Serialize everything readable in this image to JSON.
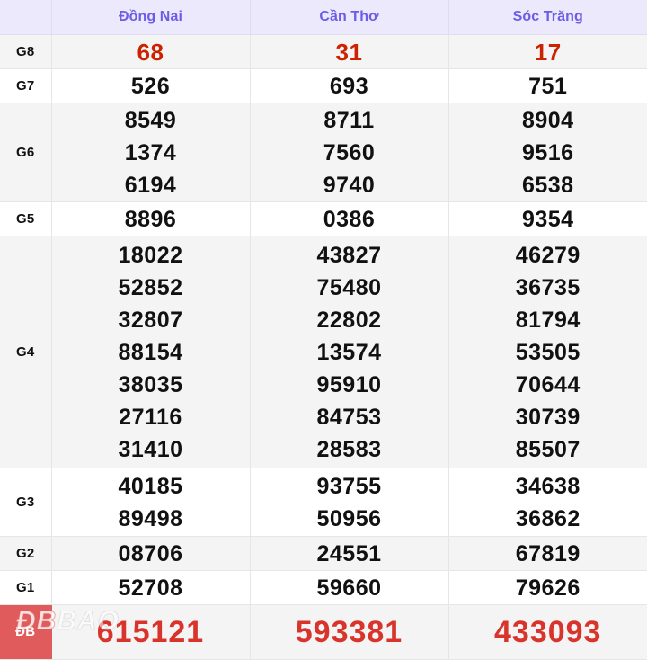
{
  "table": {
    "corner_label": "",
    "provinces": [
      "Đồng Nai",
      "Cần Thơ",
      "Sóc Trăng"
    ],
    "header_text_color": "#6c5ce7",
    "header_bg_color": "#ebe9fb",
    "accent_red": "#cc2200",
    "special_red": "#d9342b",
    "special_label_bg": "#e05c5c",
    "rows": [
      {
        "label": "G8",
        "style": "accent-red",
        "band": "grey",
        "cells": [
          [
            "68"
          ],
          [
            "31"
          ],
          [
            "17"
          ]
        ]
      },
      {
        "label": "G7",
        "style": "plain",
        "band": "white",
        "cells": [
          [
            "526"
          ],
          [
            "693"
          ],
          [
            "751"
          ]
        ]
      },
      {
        "label": "G6",
        "style": "plain",
        "band": "grey",
        "cells": [
          [
            "8549",
            "1374",
            "6194"
          ],
          [
            "8711",
            "7560",
            "9740"
          ],
          [
            "8904",
            "9516",
            "6538"
          ]
        ]
      },
      {
        "label": "G5",
        "style": "plain",
        "band": "white",
        "cells": [
          [
            "8896"
          ],
          [
            "0386"
          ],
          [
            "9354"
          ]
        ]
      },
      {
        "label": "G4",
        "style": "plain",
        "band": "grey",
        "cells": [
          [
            "18022",
            "52852",
            "32807",
            "88154",
            "38035",
            "27116",
            "31410"
          ],
          [
            "43827",
            "75480",
            "22802",
            "13574",
            "95910",
            "84753",
            "28583"
          ],
          [
            "46279",
            "36735",
            "81794",
            "53505",
            "70644",
            "30739",
            "85507"
          ]
        ]
      },
      {
        "label": "G3",
        "style": "plain",
        "band": "white",
        "cells": [
          [
            "40185",
            "89498"
          ],
          [
            "93755",
            "50956"
          ],
          [
            "34638",
            "36862"
          ]
        ]
      },
      {
        "label": "G2",
        "style": "plain",
        "band": "grey",
        "cells": [
          [
            "08706"
          ],
          [
            "24551"
          ],
          [
            "67819"
          ]
        ]
      },
      {
        "label": "G1",
        "style": "plain",
        "band": "white",
        "cells": [
          [
            "52708"
          ],
          [
            "59660"
          ],
          [
            "79626"
          ]
        ]
      },
      {
        "label": "ĐB",
        "style": "special",
        "band": "special",
        "cells": [
          [
            "615121"
          ],
          [
            "593381"
          ],
          [
            "433093"
          ]
        ]
      }
    ]
  },
  "watermark": {
    "line1": "ĐB",
    "line2": "BAO"
  }
}
